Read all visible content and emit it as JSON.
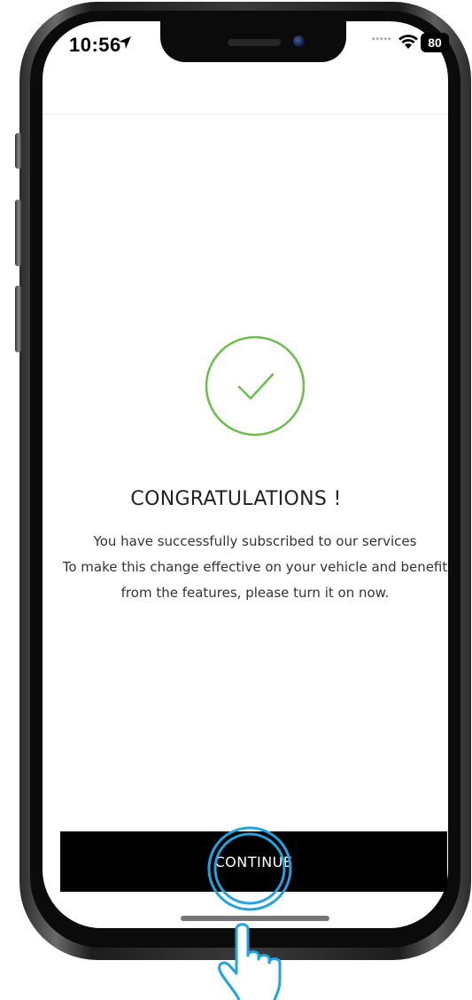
{
  "status_bar": {
    "time": "10:56",
    "battery": "80",
    "icons": [
      "location-arrow-icon",
      "wifi-icon",
      "battery-icon"
    ]
  },
  "success": {
    "icon": "check-circle-icon",
    "title": "CONGRATULATIONS !",
    "message_lines": [
      "You have successfully subscribed to our services",
      "To make this change  effective on your vehicle and benefit",
      "from the features, please turn it on now."
    ]
  },
  "footer": {
    "continue_label": "CONTINUE"
  },
  "overlay": {
    "gesture_icon": "tap-hand-icon"
  },
  "colors": {
    "accent_check": "#6abf4b",
    "button_bg": "#000000",
    "tap_highlight": "#1fa3e3"
  }
}
